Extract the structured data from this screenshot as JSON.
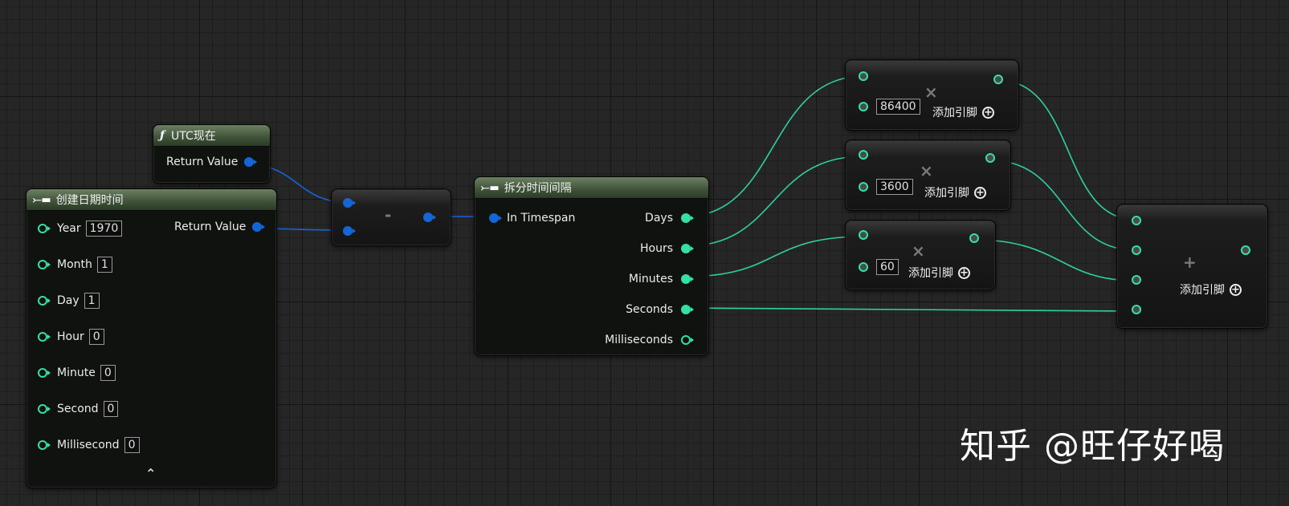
{
  "utc_node": {
    "title": "UTC现在",
    "output": "Return Value"
  },
  "make_datetime": {
    "title": "创建日期时间",
    "inputs": [
      {
        "label": "Year",
        "value": "1970"
      },
      {
        "label": "Month",
        "value": "1"
      },
      {
        "label": "Day",
        "value": "1"
      },
      {
        "label": "Hour",
        "value": "0"
      },
      {
        "label": "Minute",
        "value": "0"
      },
      {
        "label": "Second",
        "value": "0"
      },
      {
        "label": "Millisecond",
        "value": "0"
      }
    ],
    "output": "Return Value",
    "collapse_glyph": "⌃"
  },
  "subtract_node": {
    "symbol": "-"
  },
  "break_timespan": {
    "title": "拆分时间间隔",
    "input": "In Timespan",
    "outputs": [
      "Days",
      "Hours",
      "Minutes",
      "Seconds",
      "Milliseconds"
    ]
  },
  "multiply_nodes": [
    {
      "symbol": "×",
      "value": "86400",
      "add_pin": "添加引脚"
    },
    {
      "symbol": "×",
      "value": "3600",
      "add_pin": "添加引脚"
    },
    {
      "symbol": "×",
      "value": "60",
      "add_pin": "添加引脚"
    }
  ],
  "add_node": {
    "symbol": "+",
    "add_pin": "添加引脚"
  },
  "watermark": "知乎 @旺仔好喝",
  "colors": {
    "int_wire": "#2fd0a0",
    "struct_wire": "#1565d6",
    "grid_bg": "#262626"
  }
}
